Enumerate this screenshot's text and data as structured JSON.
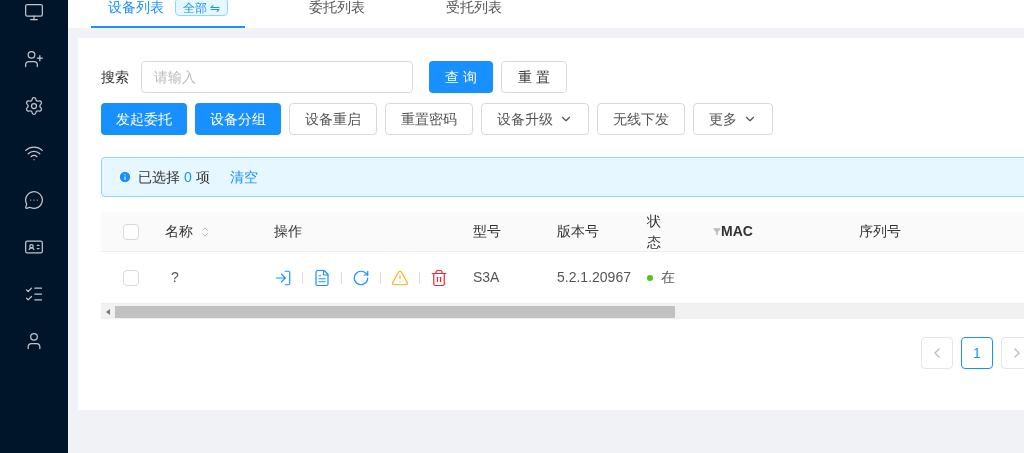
{
  "tabs": [
    {
      "label": "设备列表",
      "selected": true,
      "badge": "全部 ⇋"
    },
    {
      "label": "委托列表",
      "selected": false
    },
    {
      "label": "受托列表",
      "selected": false
    }
  ],
  "search": {
    "label": "搜索",
    "placeholder": "请输入",
    "buttons": [
      {
        "label": "查 询",
        "kind": "primary"
      },
      {
        "label": "重 置",
        "kind": "default"
      }
    ]
  },
  "actions": [
    {
      "label": "发起委托",
      "kind": "primary",
      "dropdown": false
    },
    {
      "label": "设备分组",
      "kind": "primary",
      "dropdown": false
    },
    {
      "label": "设备重启",
      "kind": "default",
      "dropdown": false
    },
    {
      "label": "重置密码",
      "kind": "default",
      "dropdown": false
    },
    {
      "label": "设备升级",
      "kind": "default",
      "dropdown": true
    },
    {
      "label": "无线下发",
      "kind": "default",
      "dropdown": false
    },
    {
      "label": "更多",
      "kind": "default",
      "dropdown": true
    }
  ],
  "selection": {
    "prefix": "已选择",
    "count": "0",
    "suffix": "项",
    "clear": "清空"
  },
  "table": {
    "select_all_checked": false,
    "columns": [
      {
        "label": "名称",
        "sortable": true,
        "filter": false
      },
      {
        "label": "操作",
        "sortable": false,
        "filter": false
      },
      {
        "label": "型号",
        "sortable": false,
        "filter": false
      },
      {
        "label": "版本号",
        "sortable": false,
        "filter": false
      },
      {
        "label": "状态",
        "sortable": false,
        "filter": true
      },
      {
        "label": "MAC",
        "sortable": false,
        "filter": false
      },
      {
        "label": "序列号",
        "sortable": false,
        "filter": false
      }
    ],
    "rows": [
      {
        "checked": false,
        "name": "?",
        "actions": [
          {
            "kind": "enter"
          },
          {
            "kind": "document"
          },
          {
            "kind": "refresh"
          },
          {
            "kind": "warning"
          },
          {
            "kind": "delete"
          }
        ],
        "model": "S3A",
        "version": "5.2.1.20967",
        "status": "在"
      }
    ]
  },
  "pagination": {
    "pages": [
      {
        "label": "1",
        "selected": true
      }
    ]
  }
}
